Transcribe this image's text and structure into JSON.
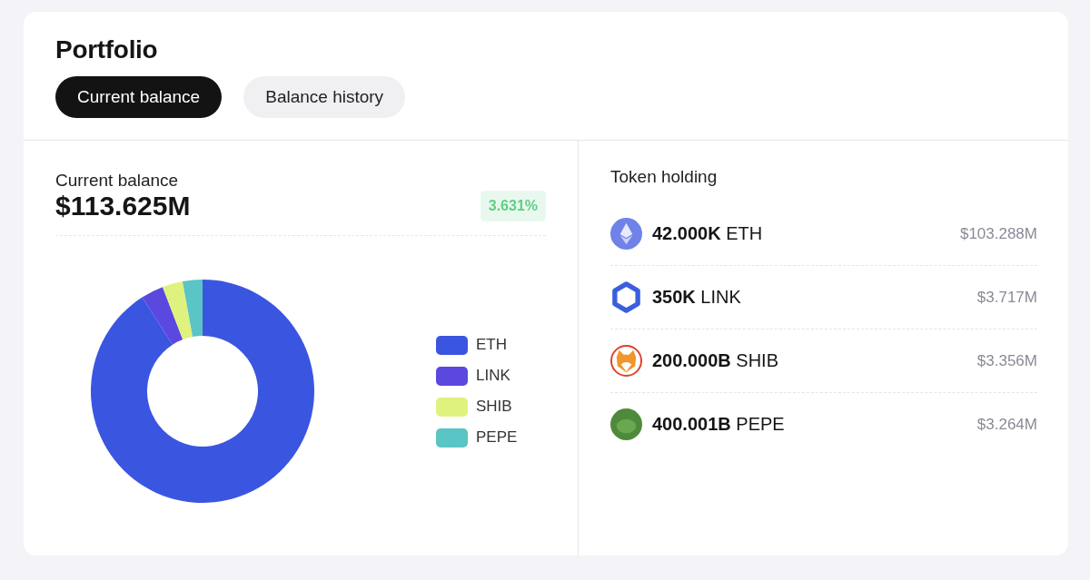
{
  "title": "Portfolio",
  "tabs": [
    {
      "label": "Current balance",
      "selected": true
    },
    {
      "label": "Balance history",
      "selected": false
    }
  ],
  "balance": {
    "label": "Current balance",
    "value": "$113.625M",
    "change": "3.631%"
  },
  "chart_data": {
    "type": "donut",
    "categories": [
      "ETH",
      "LINK",
      "SHIB",
      "PEPE"
    ],
    "colors": [
      "#3a56e0",
      "#5b48de",
      "#e0f27e",
      "#5bc4c4"
    ],
    "legend": true,
    "series": [
      {
        "values": [
          90.91,
          3.27,
          2.95,
          2.87
        ]
      }
    ]
  },
  "holdings": {
    "title": "Token holding",
    "tokens": [
      {
        "kind": "eth",
        "amount": "42.000K",
        "symbol": "ETH",
        "value": "$103.288M"
      },
      {
        "kind": "link",
        "amount": "350K",
        "symbol": "LINK",
        "value": "$3.717M"
      },
      {
        "kind": "shib",
        "amount": "200.000B",
        "symbol": "SHIB",
        "value": "$3.356M"
      },
      {
        "kind": "pepe",
        "amount": "400.001B",
        "symbol": "PEPE",
        "value": "$3.264M"
      }
    ]
  }
}
